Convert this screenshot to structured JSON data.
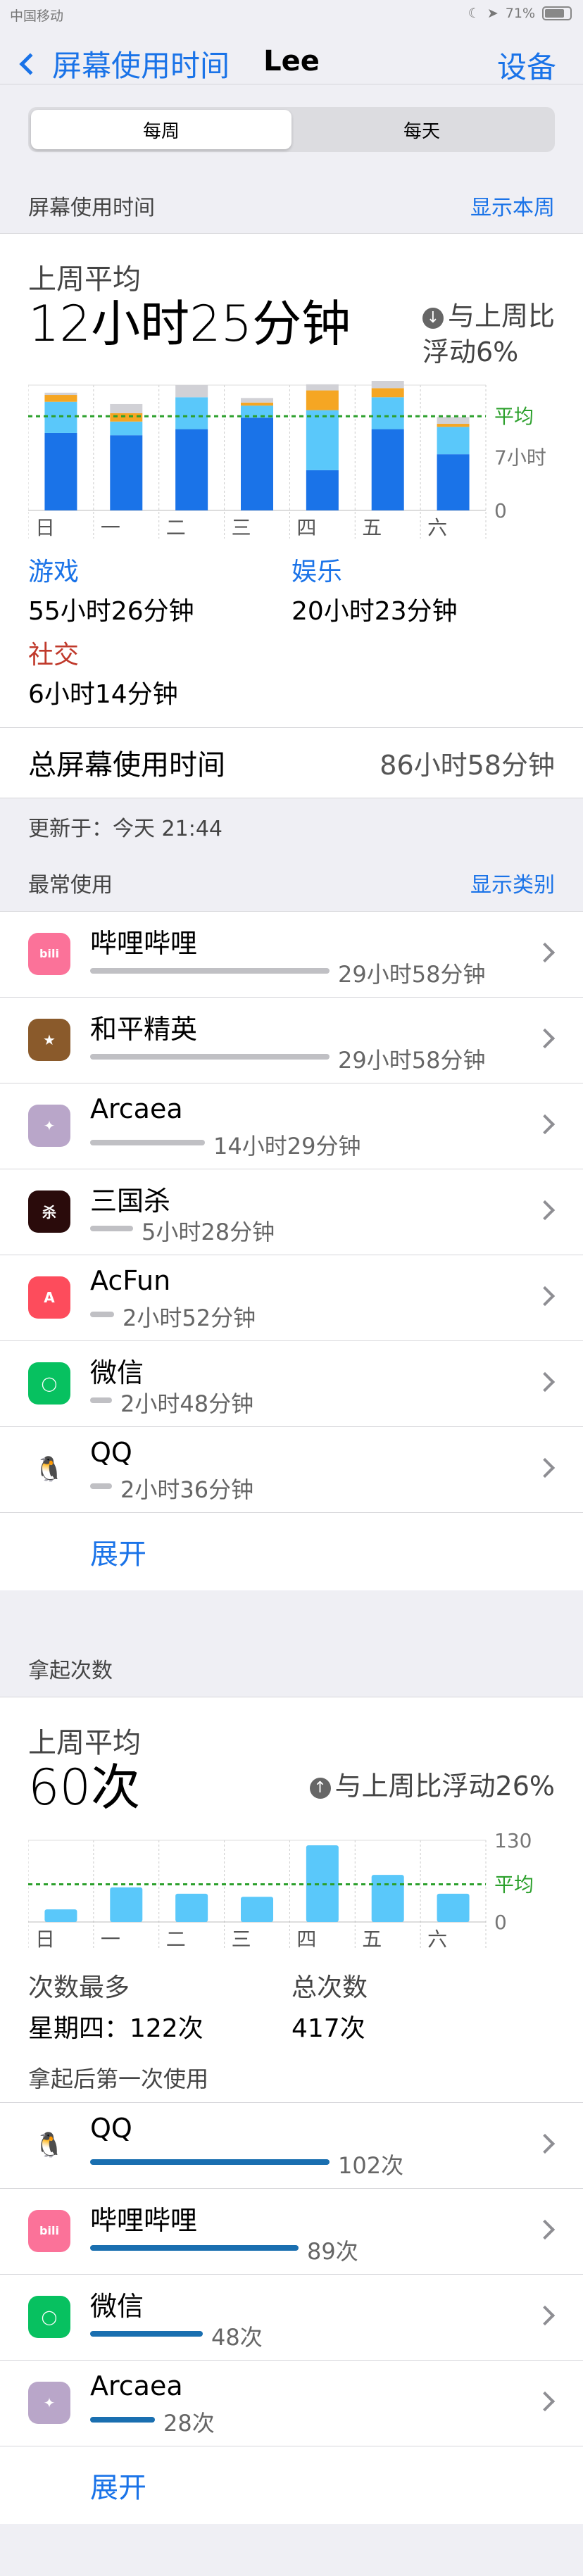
{
  "status": {
    "carrier": "中国移动",
    "battery": "71%",
    "battery_level": 0.71
  },
  "nav": {
    "back_label": "屏幕使用时间",
    "title": "Lee",
    "settings_label": "设备"
  },
  "segment": {
    "week": "每周",
    "day": "每天"
  },
  "screen_time": {
    "section_title": "屏幕使用时间",
    "section_link": "显示本周",
    "avg_label": "上周平均",
    "avg_value": "12小时25分钟",
    "compare_line1": "与上周比",
    "compare_line2": "浮动6%",
    "categories": [
      {
        "name": "游戏",
        "value": "55小时26分钟",
        "color": "#1a73e8"
      },
      {
        "name": "娱乐",
        "value": "20小时23分钟",
        "color": "#1a73e8"
      },
      {
        "name": "社交",
        "value": "6小时14分钟",
        "color": "#c0392b"
      }
    ],
    "total_label": "总屏幕使用时间",
    "total_value": "86小时58分钟",
    "updated": "更新于：今天 21:44"
  },
  "chart_data": [
    {
      "type": "bar",
      "stacked": true,
      "categories": [
        "日",
        "一",
        "二",
        "三",
        "四",
        "五",
        "六"
      ],
      "series": [
        {
          "name": "游戏",
          "color": "#1a73e8",
          "values": [
            10.2,
            9.9,
            10.7,
            12.2,
            5.3,
            10.7,
            7.4
          ]
        },
        {
          "name": "娱乐",
          "color": "#5ac8fa",
          "values": [
            4.1,
            1.8,
            4.2,
            1.6,
            7.9,
            4.2,
            3.6
          ]
        },
        {
          "name": "社交",
          "color": "#f5a623",
          "values": [
            0.9,
            1.1,
            0.0,
            0.4,
            2.6,
            1.2,
            0.4
          ]
        },
        {
          "name": "",
          "color": "#d1d1d6",
          "values": [
            0.3,
            1.2,
            1.6,
            0.6,
            0.8,
            1.5,
            0.9
          ]
        }
      ],
      "avg": 12.4,
      "avg_label": "平均",
      "yticks": [
        {
          "value": 7,
          "label": "7小时"
        },
        {
          "value": 0,
          "label": "0"
        }
      ],
      "ylim": [
        0,
        16.5
      ]
    },
    {
      "type": "bar",
      "categories": [
        "日",
        "一",
        "二",
        "三",
        "四",
        "五",
        "六"
      ],
      "values": [
        20,
        55,
        45,
        40,
        122,
        75,
        45
      ],
      "avg": 60,
      "avg_label": "平均",
      "yticks": [
        {
          "value": 130,
          "label": "130"
        },
        {
          "value": 0,
          "label": "0"
        }
      ],
      "ylim": [
        0,
        130
      ],
      "color": "#5ac8fa"
    }
  ],
  "most_used": {
    "title": "最常使用",
    "link": "显示类别",
    "apps": [
      {
        "name": "哔哩哔哩",
        "value": "29小时58分钟",
        "fraction": 1.0,
        "icon": "bilibili-icon",
        "bg": "#fb7299",
        "glyph": "bili"
      },
      {
        "name": "和平精英",
        "value": "29小时58分钟",
        "fraction": 1.0,
        "icon": "peace-elite-icon",
        "bg": "#8a5a2b",
        "glyph": "★"
      },
      {
        "name": "Arcaea",
        "value": "14小时29分钟",
        "fraction": 0.48,
        "icon": "arcaea-icon",
        "bg": "#b9a6c9",
        "glyph": "✦"
      },
      {
        "name": "三国杀",
        "value": "5小时28分钟",
        "fraction": 0.18,
        "icon": "sanguosha-icon",
        "bg": "#2a0b0b",
        "glyph": "杀"
      },
      {
        "name": "AcFun",
        "value": "2小时52分钟",
        "fraction": 0.1,
        "icon": "acfun-icon",
        "bg": "#fd4c5c",
        "glyph": "A"
      },
      {
        "name": "微信",
        "value": "2小时48分钟",
        "fraction": 0.09,
        "icon": "wechat-icon",
        "bg": "#07c160",
        "glyph": "◯"
      },
      {
        "name": "QQ",
        "value": "2小时36分钟",
        "fraction": 0.09,
        "icon": "qq-icon",
        "bg": "#ffffff",
        "glyph": "🐧"
      }
    ],
    "expand": "展开"
  },
  "pickups": {
    "title": "拿起次数",
    "avg_label": "上周平均",
    "avg_value": "60次",
    "compare": "与上周比浮动26%",
    "most_label": "次数最多",
    "most_value": "星期四：122次",
    "total_label": "总次数",
    "total_value": "417次",
    "first_used_title": "拿起后第一次使用",
    "apps": [
      {
        "name": "QQ",
        "value": "102次",
        "fraction": 1.0,
        "icon": "qq-icon",
        "bg": "#ffffff",
        "glyph": "🐧"
      },
      {
        "name": "哔哩哔哩",
        "value": "89次",
        "fraction": 0.87,
        "icon": "bilibili-icon",
        "bg": "#fb7299",
        "glyph": "bili"
      },
      {
        "name": "微信",
        "value": "48次",
        "fraction": 0.47,
        "icon": "wechat-icon",
        "bg": "#07c160",
        "glyph": "◯"
      },
      {
        "name": "Arcaea",
        "value": "28次",
        "fraction": 0.27,
        "icon": "arcaea-icon",
        "bg": "#b9a6c9",
        "glyph": "✦"
      }
    ],
    "expand": "展开"
  }
}
